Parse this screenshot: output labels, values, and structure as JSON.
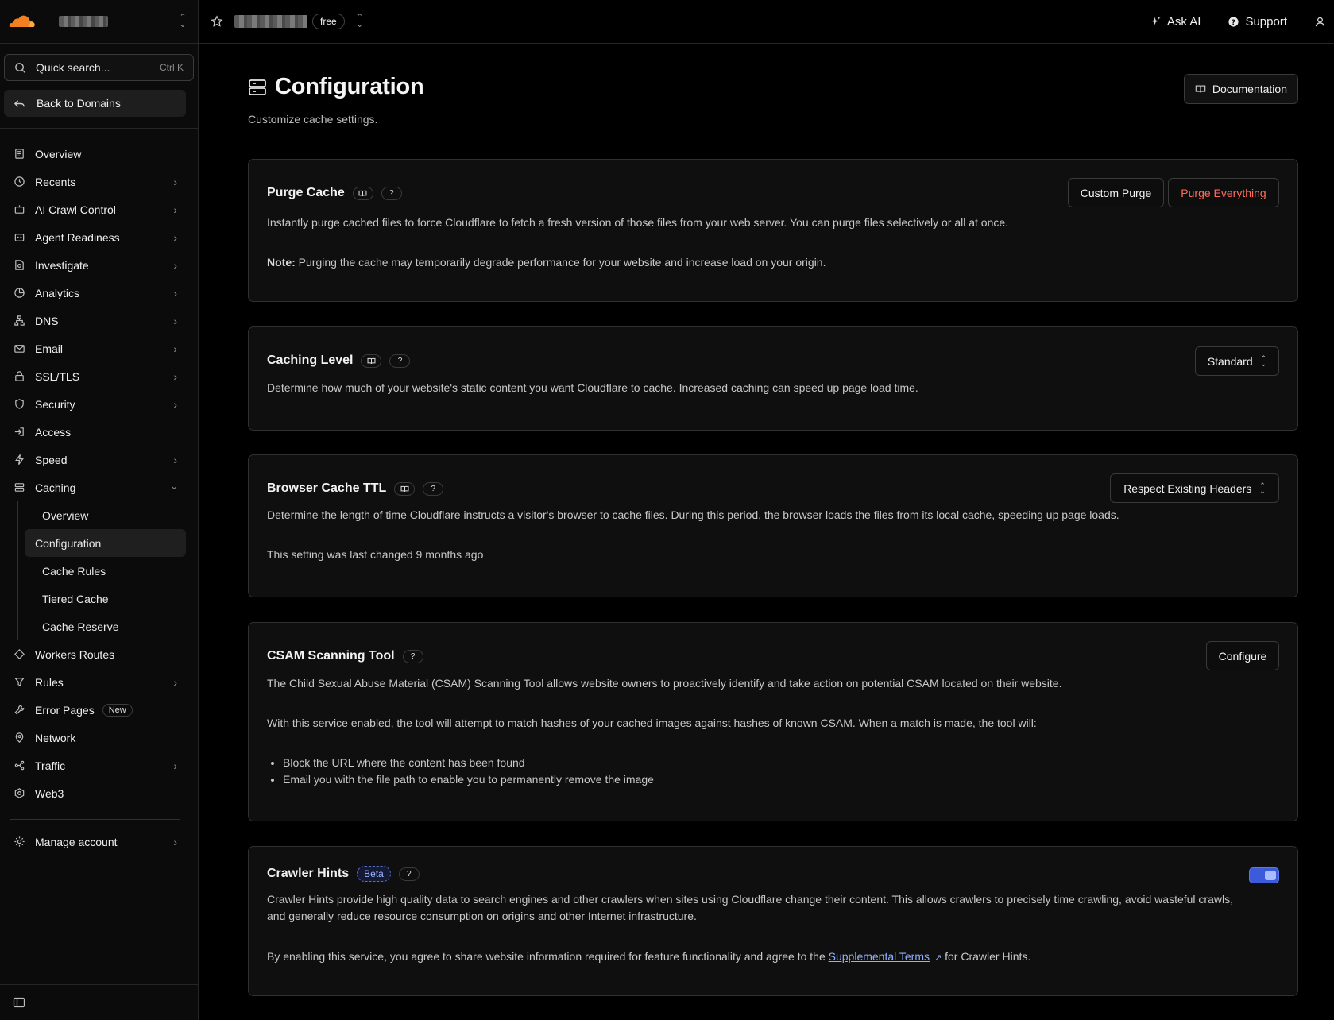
{
  "sidebar": {
    "search": {
      "placeholder": "Quick search...",
      "shortcut": "Ctrl K"
    },
    "back_label": "Back to Domains",
    "items": [
      {
        "label": "Overview",
        "icon": "document-icon",
        "arrow": false
      },
      {
        "label": "Recents",
        "icon": "clock-icon",
        "arrow": true
      },
      {
        "label": "AI Crawl Control",
        "icon": "robot-icon",
        "arrow": true
      },
      {
        "label": "Agent Readiness",
        "icon": "agent-icon",
        "arrow": true
      },
      {
        "label": "Investigate",
        "icon": "investigate-icon",
        "arrow": true
      },
      {
        "label": "Analytics",
        "icon": "pie-chart-icon",
        "arrow": true
      },
      {
        "label": "DNS",
        "icon": "network-tree-icon",
        "arrow": true
      },
      {
        "label": "Email",
        "icon": "mail-icon",
        "arrow": true
      },
      {
        "label": "SSL/TLS",
        "icon": "lock-icon",
        "arrow": true
      },
      {
        "label": "Security",
        "icon": "shield-icon",
        "arrow": true
      },
      {
        "label": "Access",
        "icon": "access-icon",
        "arrow": false
      },
      {
        "label": "Speed",
        "icon": "lightning-icon",
        "arrow": true
      },
      {
        "label": "Caching",
        "icon": "server-icon",
        "arrow": "down"
      }
    ],
    "caching_sub": [
      "Overview",
      "Configuration",
      "Cache Rules",
      "Tiered Cache",
      "Cache Reserve"
    ],
    "items_after": [
      {
        "label": "Workers Routes",
        "icon": "workers-icon",
        "arrow": false
      },
      {
        "label": "Rules",
        "icon": "funnel-icon",
        "arrow": true
      },
      {
        "label": "Error Pages",
        "icon": "wrench-icon",
        "arrow": false,
        "badge": "New"
      },
      {
        "label": "Network",
        "icon": "location-pin-icon",
        "arrow": false
      },
      {
        "label": "Traffic",
        "icon": "traffic-icon",
        "arrow": true
      },
      {
        "label": "Web3",
        "icon": "web3-icon",
        "arrow": false
      }
    ],
    "manage_account": "Manage account"
  },
  "topbar": {
    "plan": "free",
    "ask_ai": "Ask AI",
    "support": "Support"
  },
  "page": {
    "title": "Configuration",
    "subtitle": "Customize cache settings.",
    "doc_button": "Documentation"
  },
  "cards": {
    "purge": {
      "title": "Purge Cache",
      "text": "Instantly purge cached files to force Cloudflare to fetch a fresh version of those files from your web server. You can purge files selectively or all at once.",
      "note_label": "Note:",
      "note_text": " Purging the cache may temporarily degrade performance for your website and increase load on your origin.",
      "custom_button": "Custom Purge",
      "everything_button": "Purge Everything"
    },
    "level": {
      "title": "Caching Level",
      "text": "Determine how much of your website's static content you want Cloudflare to cache. Increased caching can speed up page load time.",
      "select_value": "Standard"
    },
    "ttl": {
      "title": "Browser Cache TTL",
      "text": "Determine the length of time Cloudflare instructs a visitor's browser to cache files. During this period, the browser loads the files from its local cache, speeding up page loads.",
      "changed": "This setting was last changed 9 months ago",
      "select_value": "Respect Existing Headers"
    },
    "csam": {
      "title": "CSAM Scanning Tool",
      "text1": "The Child Sexual Abuse Material (CSAM) Scanning Tool allows website owners to proactively identify and take action on potential CSAM located on their website.",
      "text2": "With this service enabled, the tool will attempt to match hashes of your cached images against hashes of known CSAM. When a match is made, the tool will:",
      "bullets": [
        "Block the URL where the content has been found",
        "Email you with the file path to enable you to permanently remove the image"
      ],
      "configure_button": "Configure"
    },
    "crawler": {
      "title": "Crawler Hints",
      "badge": "Beta",
      "text1": "Crawler Hints provide high quality data to search engines and other crawlers when sites using Cloudflare change their content. This allows crawlers to precisely time crawling, avoid wasteful crawls, and generally reduce resource consumption on origins and other Internet infrastructure.",
      "text2_pre": "By enabling this service, you agree to share website information required for feature functionality and agree to the ",
      "text2_link": "Supplemental Terms",
      "text2_post": " for Crawler Hints.",
      "enabled": true
    }
  },
  "colors": {
    "accent": "#3b5bdb",
    "danger": "#ff6b5b",
    "brand": "#f38020"
  }
}
